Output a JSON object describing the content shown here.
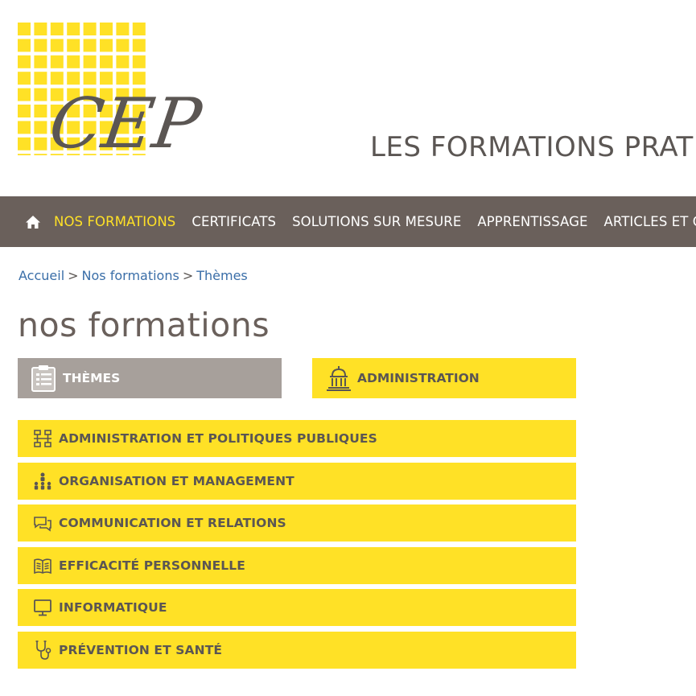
{
  "header": {
    "logo_text": "CEP",
    "tagline": "LES FORMATIONS PRAT"
  },
  "nav": {
    "items": [
      {
        "label": "NOS FORMATIONS",
        "active": true
      },
      {
        "label": "CERTIFICATS"
      },
      {
        "label": "SOLUTIONS SUR MESURE"
      },
      {
        "label": "APPRENTISSAGE"
      },
      {
        "label": "ARTICLES ET C"
      }
    ]
  },
  "breadcrumb": {
    "items": [
      "Accueil",
      "Nos formations",
      "Thèmes"
    ],
    "separator": ">"
  },
  "page": {
    "title": "nos formations"
  },
  "filters": {
    "themes_label": "THÈMES",
    "admin_label": "ADMINISTRATION"
  },
  "themes": [
    {
      "label": "ADMINISTRATION ET POLITIQUES PUBLIQUES",
      "icon": "network-icon"
    },
    {
      "label": "ORGANISATION ET MANAGEMENT",
      "icon": "org-chart-icon"
    },
    {
      "label": "COMMUNICATION ET RELATIONS",
      "icon": "chat-icon"
    },
    {
      "label": "EFFICACITÉ PERSONNELLE",
      "icon": "book-icon"
    },
    {
      "label": "INFORMATIQUE",
      "icon": "monitor-icon"
    },
    {
      "label": "PRÉVENTION ET SANTÉ",
      "icon": "stethoscope-icon"
    }
  ],
  "colors": {
    "brand_yellow": "#ffe126",
    "nav_bg": "#6a605b",
    "text_dark": "#5b5653",
    "link_blue": "#3a6ea8",
    "tab_grey": "#a7a09b"
  }
}
